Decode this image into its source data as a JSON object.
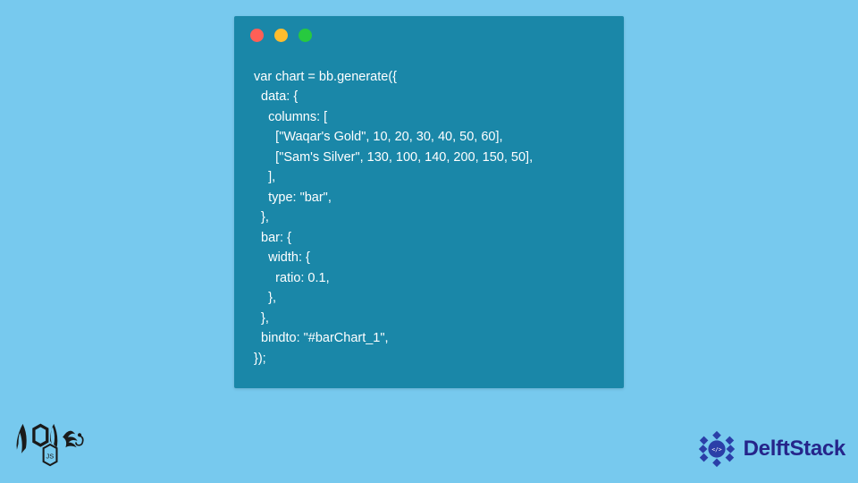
{
  "code_block": {
    "lines": [
      "var chart = bb.generate({",
      "  data: {",
      "    columns: [",
      "      [\"Waqar's Gold\", 10, 20, 30, 40, 50, 60],",
      "      [\"Sam's Silver\", 130, 100, 140, 200, 150, 50],",
      "    ],",
      "    type: \"bar\",",
      "  },",
      "  bar: {",
      "    width: {",
      "      ratio: 0.1,",
      "    },",
      "  },",
      "  bindto: \"#barChart_1\",",
      "});"
    ]
  },
  "logos": {
    "node": "node",
    "delft": "DelftStack"
  },
  "colors": {
    "bg": "#77c9ee",
    "card": "#1a87a8",
    "red": "#ff5f56",
    "yellow": "#ffbd2e",
    "green": "#27c93f",
    "delft": "#25258a"
  }
}
